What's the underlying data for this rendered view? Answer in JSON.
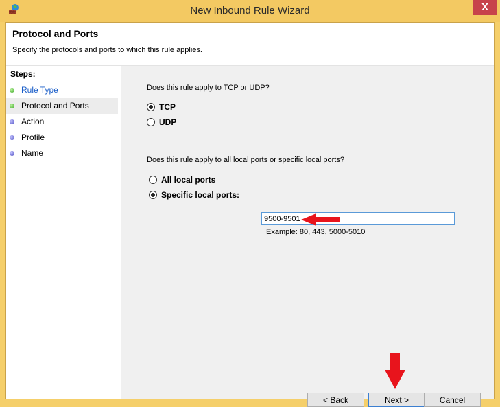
{
  "window": {
    "title": "New Inbound Rule Wizard",
    "close_label": "X",
    "app_icon": "firewall-icon"
  },
  "header": {
    "title": "Protocol and Ports",
    "subtitle": "Specify the protocols and ports to which this rule applies."
  },
  "sidebar": {
    "steps_label": "Steps:",
    "steps": [
      {
        "label": "Rule Type",
        "status": "done",
        "link": true
      },
      {
        "label": "Protocol and Ports",
        "status": "current"
      },
      {
        "label": "Action",
        "status": "pending"
      },
      {
        "label": "Profile",
        "status": "pending"
      },
      {
        "label": "Name",
        "status": "pending"
      }
    ]
  },
  "protocol": {
    "question": "Does this rule apply to TCP or UDP?",
    "options": [
      {
        "label": "TCP",
        "selected": true
      },
      {
        "label": "UDP",
        "selected": false
      }
    ]
  },
  "ports": {
    "question": "Does this rule apply to all local ports or specific local ports?",
    "options": [
      {
        "label": "All local ports",
        "selected": false
      },
      {
        "label": "Specific local ports:",
        "selected": true
      }
    ],
    "value": "9500-9501",
    "example": "Example: 80, 443, 5000-5010"
  },
  "annotations": {
    "arrow_color": "#e8141c"
  },
  "buttons": {
    "back": "< Back",
    "next": "Next >",
    "cancel": "Cancel"
  }
}
